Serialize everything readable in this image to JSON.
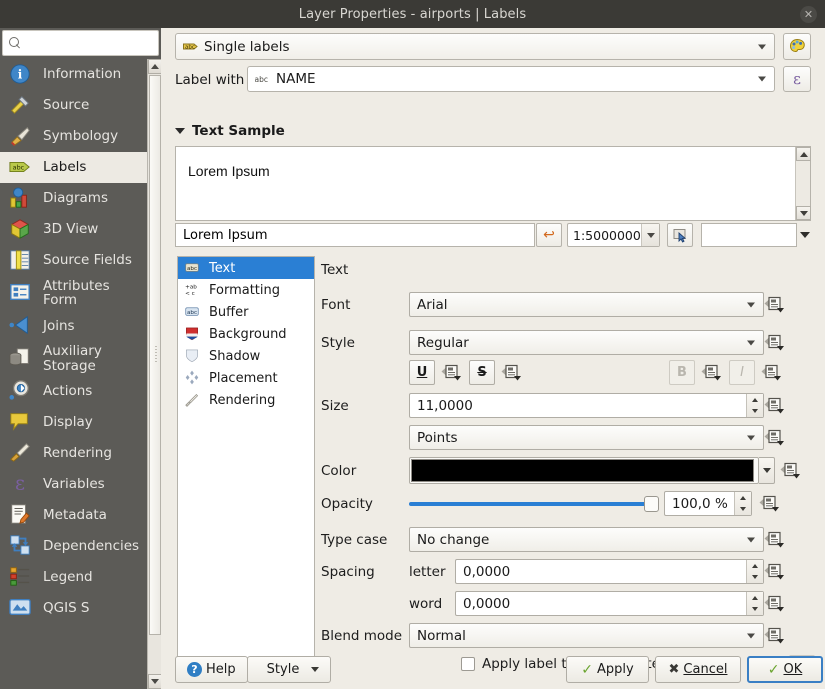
{
  "window": {
    "title": "Layer Properties - airports | Labels",
    "close_label": "✕"
  },
  "sidebar": {
    "search_placeholder": "",
    "search_value": "",
    "items": [
      {
        "label": "Information",
        "icon": "information-icon",
        "selected": false
      },
      {
        "label": "Source",
        "icon": "source-icon",
        "selected": false
      },
      {
        "label": "Symbology",
        "icon": "symbology-icon",
        "selected": false
      },
      {
        "label": "Labels",
        "icon": "labels-icon",
        "selected": true
      },
      {
        "label": "Diagrams",
        "icon": "diagrams-icon",
        "selected": false
      },
      {
        "label": "3D View",
        "icon": "cube-icon",
        "selected": false
      },
      {
        "label": "Source Fields",
        "icon": "fields-icon",
        "selected": false
      },
      {
        "label": "Attributes Form",
        "icon": "attributes-form-icon",
        "selected": false
      },
      {
        "label": "Joins",
        "icon": "joins-icon",
        "selected": false
      },
      {
        "label": "Auxiliary Storage",
        "icon": "auxiliary-storage-icon",
        "selected": false
      },
      {
        "label": "Actions",
        "icon": "actions-gear-icon",
        "selected": false
      },
      {
        "label": "Display",
        "icon": "display-balloon-icon",
        "selected": false
      },
      {
        "label": "Rendering",
        "icon": "rendering-brush-icon",
        "selected": false
      },
      {
        "label": "Variables",
        "icon": "variables-epsilon-icon",
        "selected": false
      },
      {
        "label": "Metadata",
        "icon": "metadata-icon",
        "selected": false
      },
      {
        "label": "Dependencies",
        "icon": "dependencies-icon",
        "selected": false
      },
      {
        "label": "Legend",
        "icon": "legend-icon",
        "selected": false
      },
      {
        "label": "QGIS S",
        "icon": "qgis-server-icon",
        "selected": false
      }
    ]
  },
  "header": {
    "mode_value": "Single labels",
    "mode_icon": "abc-label-icon",
    "style_button_icon": "style-palette-icon",
    "label_with_label": "Label with",
    "label_with_value": "NAME",
    "label_with_field_icon": "abc-field-icon",
    "expression_button_icon": "epsilon-expression-icon"
  },
  "text_sample": {
    "section_title": "Text Sample",
    "preview_text": "Lorem Ipsum",
    "edit_value": "Lorem Ipsum",
    "revert_icon": "revert-arrow-icon",
    "scale_value": "1:5000000",
    "pick_icon": "cursor-pick-icon",
    "extra_combo_value": ""
  },
  "tabs": [
    {
      "label": "Text",
      "icon": "text-abc-icon",
      "selected": true
    },
    {
      "label": "Formatting",
      "icon": "formatting-icon",
      "selected": false
    },
    {
      "label": "Buffer",
      "icon": "buffer-abc-icon",
      "selected": false
    },
    {
      "label": "Background",
      "icon": "background-shield-icon",
      "selected": false
    },
    {
      "label": "Shadow",
      "icon": "shadow-shield-icon",
      "selected": false
    },
    {
      "label": "Placement",
      "icon": "placement-diamonds-icon",
      "selected": false
    },
    {
      "label": "Rendering",
      "icon": "rendering-brush-icon",
      "selected": false
    }
  ],
  "form": {
    "section_title": "Text",
    "font_label": "Font",
    "font_value": "Arial",
    "style_label": "Style",
    "style_value": "Regular",
    "underline_label": "U",
    "strikethrough_label": "S",
    "bold_label": "B",
    "italic_label": "I",
    "size_label": "Size",
    "size_value": "11,0000",
    "size_unit_value": "Points",
    "color_label": "Color",
    "color_value": "#000000",
    "opacity_label": "Opacity",
    "opacity_value": "100,0 %",
    "opacity_percent": 100,
    "type_case_label": "Type case",
    "type_case_value": "No change",
    "spacing_label": "Spacing",
    "spacing_letter_label": "letter",
    "spacing_letter_value": "0,0000",
    "spacing_word_label": "word",
    "spacing_word_value": "0,0000",
    "blend_mode_label": "Blend mode",
    "blend_mode_value": "Normal",
    "substitutes_label": "Apply label text substitutes",
    "substitutes_checked": false,
    "dots_label": "..."
  },
  "footer": {
    "help_label": "Help",
    "style_label": "Style",
    "apply_label": "Apply",
    "cancel_label": "Cancel",
    "ok_label": "OK"
  },
  "colors": {
    "accent_blue": "#2a7fd4",
    "titlebar": "#3b3a36",
    "sidebar_bg": "#5c5b57",
    "panel_bg": "#efece5",
    "check_green": "#6aa42f"
  }
}
